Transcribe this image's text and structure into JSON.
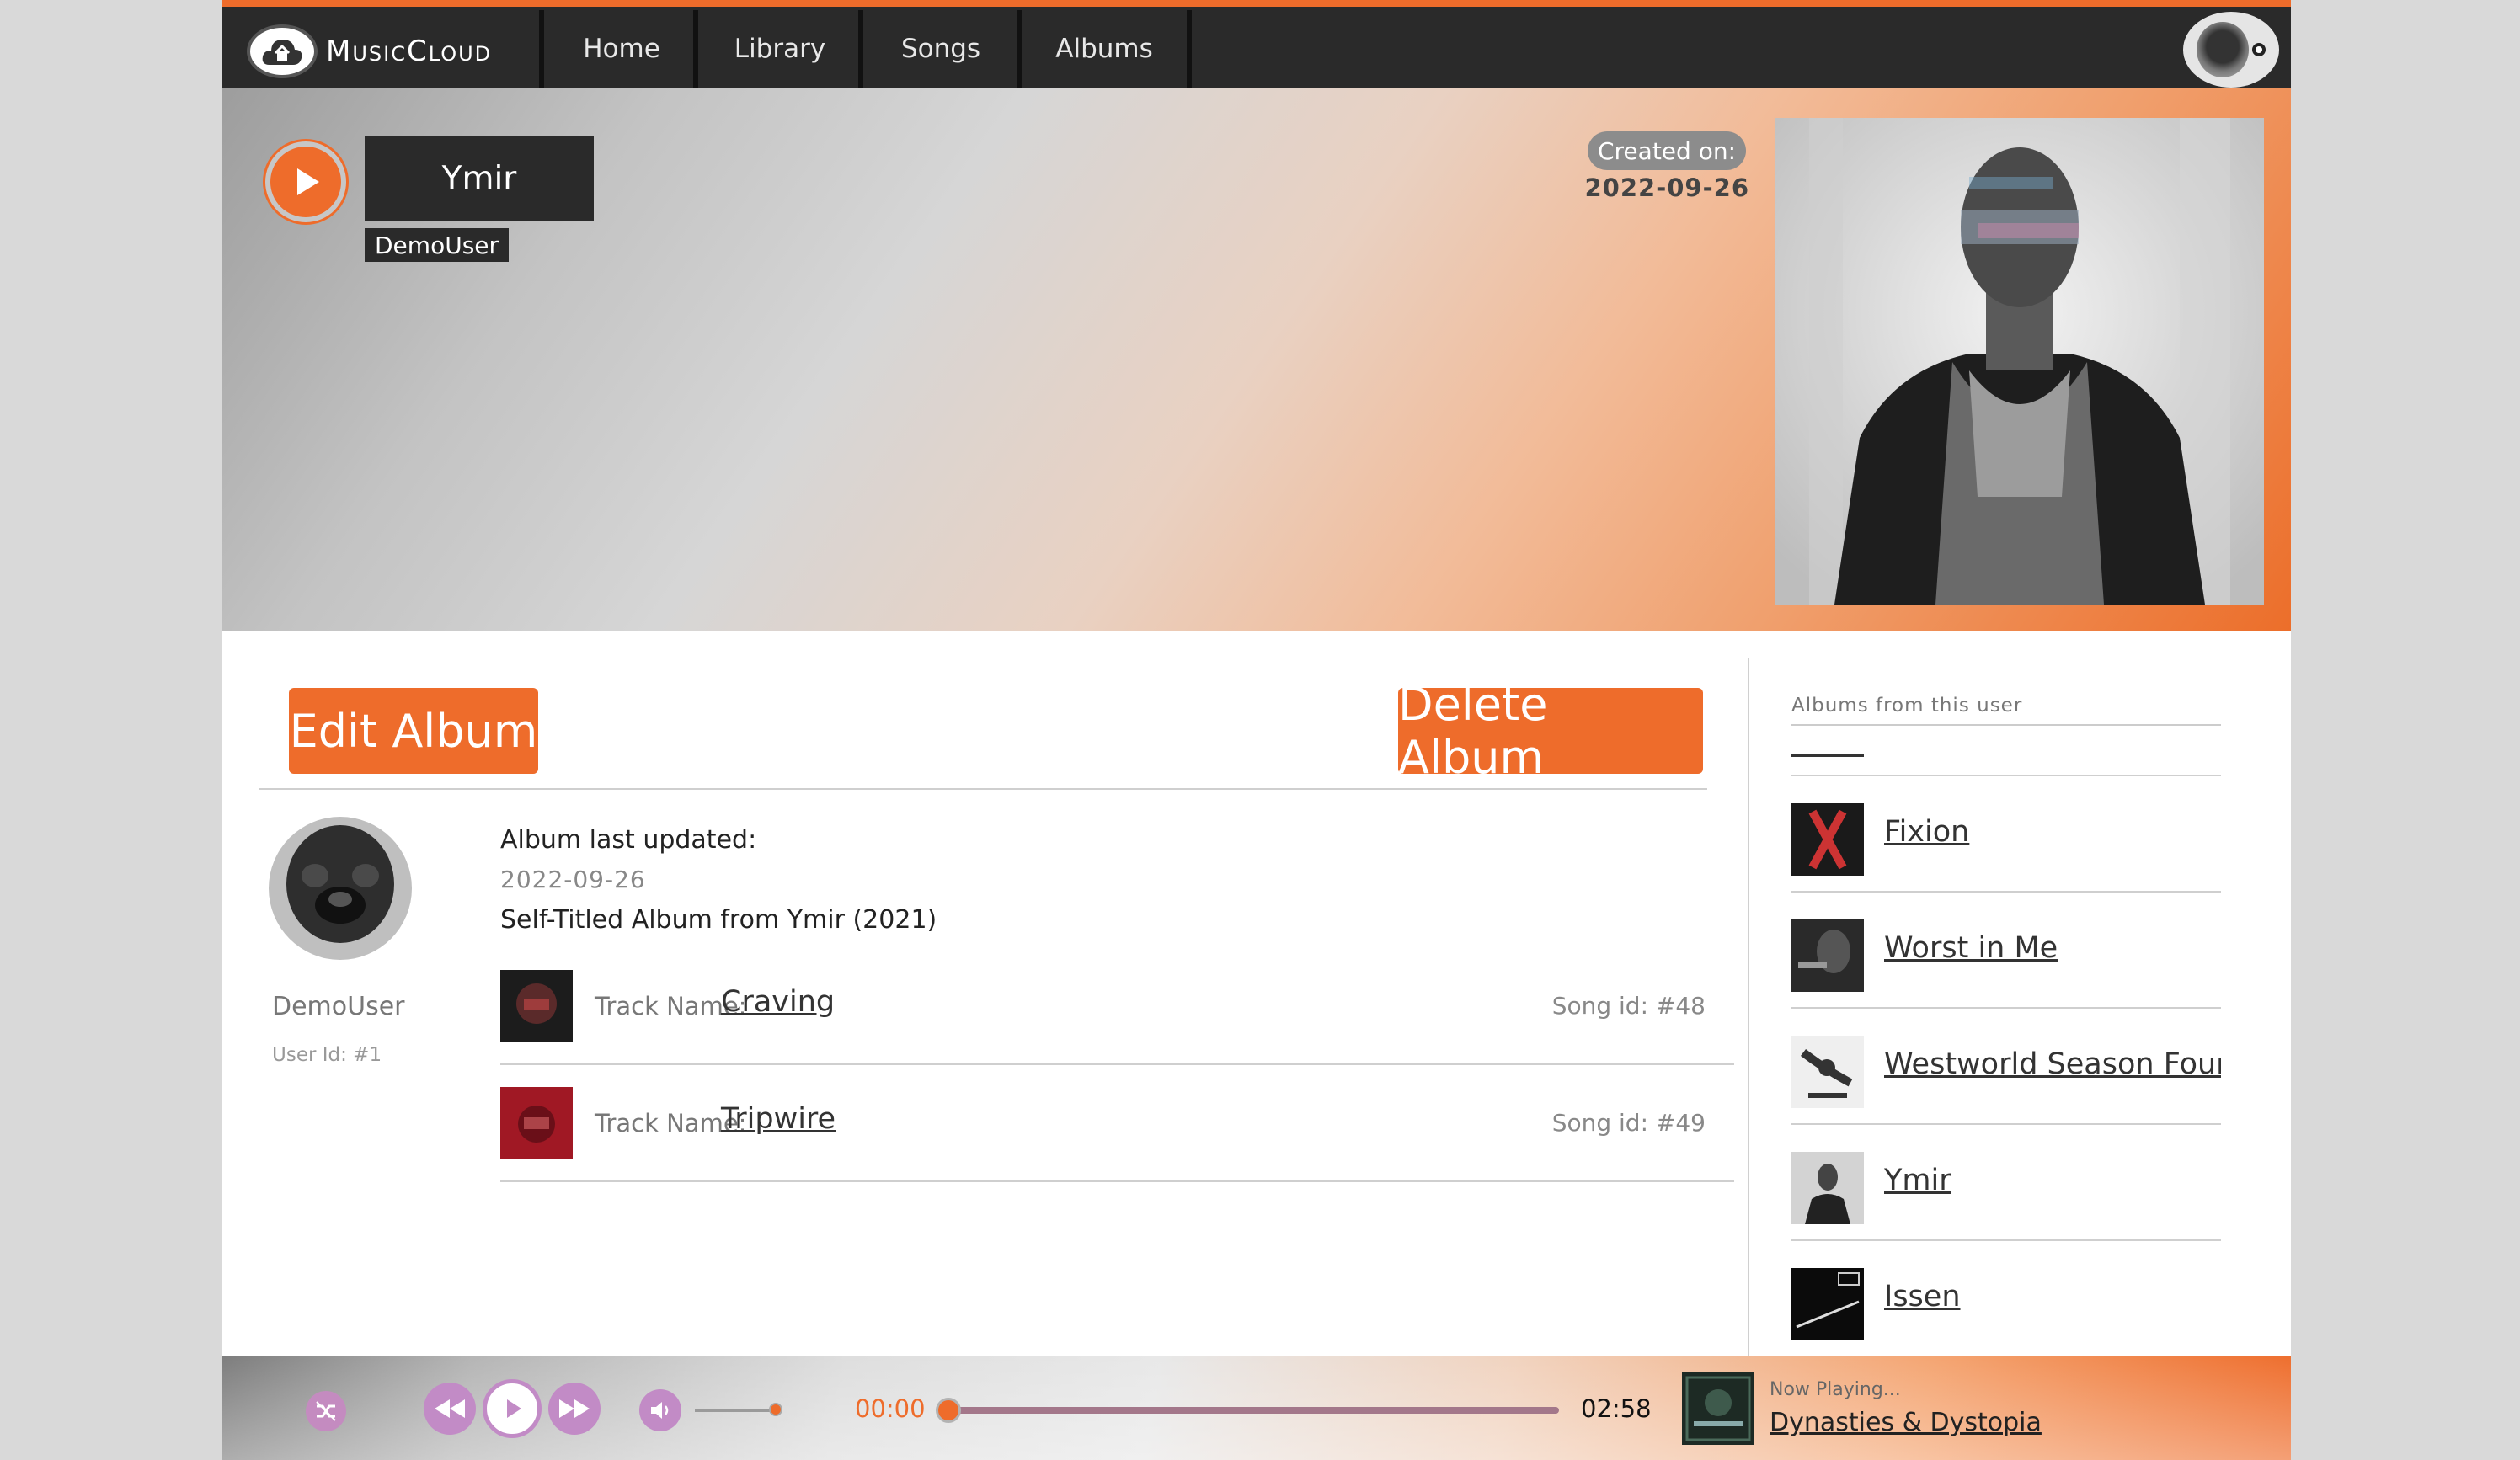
{
  "nav": {
    "brand": "MusicCloud",
    "tabs": [
      {
        "label": "Home"
      },
      {
        "label": "Library"
      },
      {
        "label": "Songs"
      },
      {
        "label": "Albums"
      }
    ]
  },
  "album": {
    "title": "Ymir",
    "owner": "DemoUser",
    "created_label": "Created on:",
    "created_date": "2022-09-26",
    "edit_label": "Edit Album",
    "delete_label": "Delete Album",
    "updated_label": "Album last updated:",
    "updated_date": "2022-09-26",
    "description": "Self-Titled Album from Ymir (2021)"
  },
  "owner": {
    "name": "DemoUser",
    "id_text": "User Id: #1"
  },
  "tracks": [
    {
      "label": "Track Name:",
      "name": "Craving",
      "song_id": "Song id: #48"
    },
    {
      "label": "Track Name:",
      "name": "Tripwire",
      "song_id": "Song id: #49"
    }
  ],
  "sidebar": {
    "heading": "Albums from this user",
    "albums": [
      {
        "title": "Fixion"
      },
      {
        "title": "Worst in Me"
      },
      {
        "title": "Westworld Season Four Soundtrack"
      },
      {
        "title": "Ymir"
      },
      {
        "title": "Issen"
      }
    ]
  },
  "player": {
    "time_current": "00:00",
    "time_total": "02:58",
    "progress": 0.0,
    "volume": 0.9,
    "now_playing_label": "Now Playing...",
    "now_playing_title": "Dynasties & Dystopia"
  },
  "colors": {
    "accent": "#ee6c2b",
    "nav_bg": "#2a2a2a",
    "player_controls": "#c28bc6"
  },
  "icons": [
    "cloud-logo-icon",
    "play-icon",
    "shuffle-icon",
    "rewind-icon",
    "forward-icon",
    "volume-icon"
  ]
}
